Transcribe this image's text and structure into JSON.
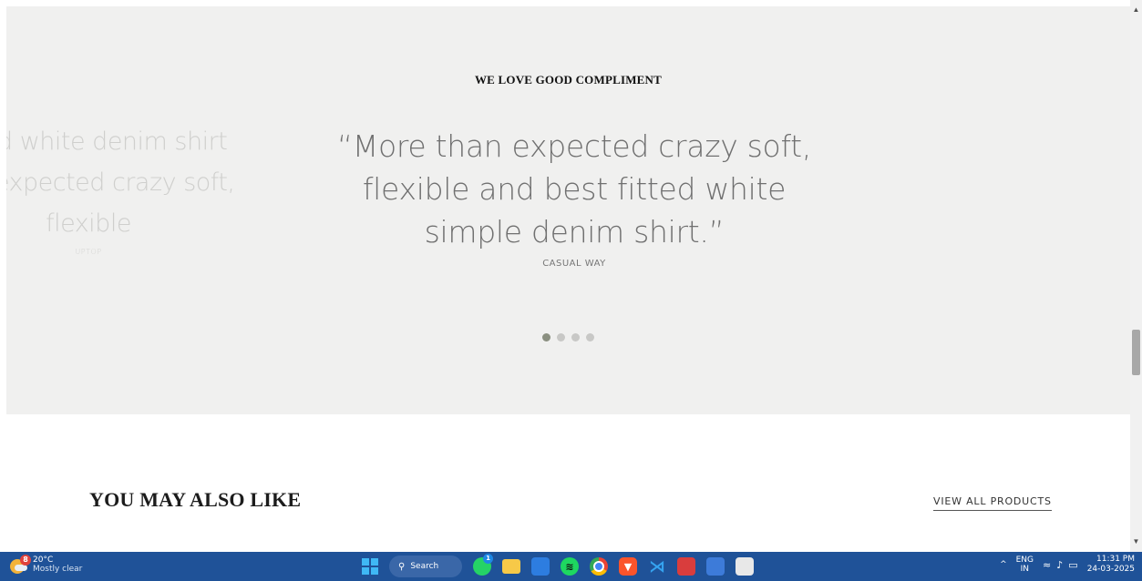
{
  "testimonials": {
    "heading": "WE LOVE GOOD COMPLIMENT",
    "prev_slide": {
      "line1": "fitted white denim shirt",
      "line2": "han expected crazy soft,",
      "line3": "flexible",
      "author": "UPTOP"
    },
    "active_slide": {
      "line1": "“More than expected crazy soft,",
      "line2": "flexible and best fitted white",
      "line3": "simple denim shirt.”",
      "author": "CASUAL WAY"
    },
    "dots_total": 4,
    "active_dot": 1
  },
  "related": {
    "title": "YOU MAY ALSO LIKE",
    "view_all": "VIEW ALL PRODUCTS"
  },
  "taskbar": {
    "weather_temp": "20°C",
    "weather_desc": "Mostly clear",
    "weather_badge": "8",
    "search_label": "Search",
    "whatsapp_badge": "1",
    "lang_top": "ENG",
    "lang_bottom": "IN",
    "time": "11:31 PM",
    "date": "24-03-2025"
  },
  "colors": {
    "section_bg": "#f0f0ef",
    "taskbar_bg": "#1f5298",
    "active_dot": "#8a8f80"
  }
}
